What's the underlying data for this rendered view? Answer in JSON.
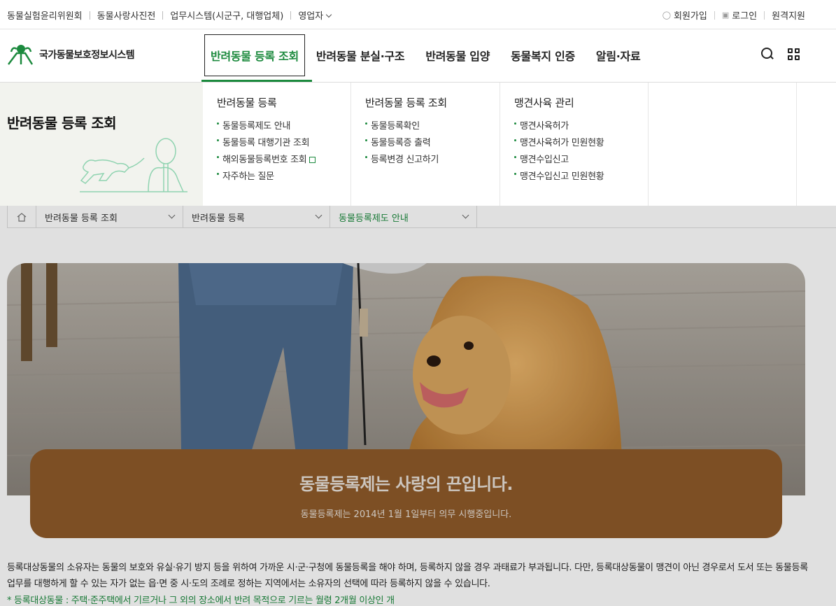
{
  "utility": {
    "left_links": [
      "동물실험윤리위원회",
      "동물사랑사진전",
      "업무시스템(시군구, 대행업체)",
      "영업자"
    ],
    "right_links": [
      "회원가입",
      "로그인",
      "원격지원"
    ]
  },
  "header": {
    "logo_text": "국가동물보호정보시스템",
    "nav": [
      "반려동물 등록 조회",
      "반려동물 분실·구조",
      "반려동물 입양",
      "동물복지 인증",
      "알림·자료"
    ],
    "icons": [
      "search-icon",
      "grid-menu-icon"
    ]
  },
  "mega": {
    "side_title": "반려동물 등록 조회",
    "columns": [
      {
        "title": "반려동물 등록",
        "items": [
          "동물등록제도 안내",
          "동물등록 대행기관 조회",
          "해외동물등록번호 조회",
          "자주하는 질문"
        ]
      },
      {
        "title": "반려동물 등록 조회",
        "items": [
          "동물등록확인",
          "동물등록증 출력",
          "등록변경 신고하기"
        ]
      },
      {
        "title": "맹견사육 관리",
        "items": [
          "맹견사육허가",
          "맹견사육허가 민원현황",
          "맹견수입신고",
          "맹견수입신고 민원현황"
        ]
      }
    ]
  },
  "breadcrumb": [
    "반려동물 등록 조회",
    "반려동물 등록",
    "동물등록제도 안내"
  ],
  "banner": {
    "title": "동물등록제는 사랑의 끈입니다.",
    "subtitle": "동물등록제는 2014년 1월 1일부터 의무 시행중입니다."
  },
  "content": {
    "paragraph": "등록대상동물의 소유자는 동물의 보호와 유실·유기 방지 등을 위하여 가까운 시·군·구청에 동물등록을 해야 하며, 등록하지 않을 경우 과태료가 부과됩니다. 다만, 등록대상동물이 맹견이 아닌 경우로서 도서 또는 동물등록 업무를 대행하게 할 수 있는 자가 없는 읍·면 중 시·도의 조례로 정하는 지역에서는 소유자의 선택에 따라 등록하지 않을 수 있습니다.",
    "note": "* 등록대상동물 : 주택·준주택에서 기르거나 그 외의 장소에서 반려 목적으로 기르는 월령 2개월 이상인 개"
  },
  "colors": {
    "accent": "#1c8a3e",
    "banner": "#8f5a2a"
  }
}
